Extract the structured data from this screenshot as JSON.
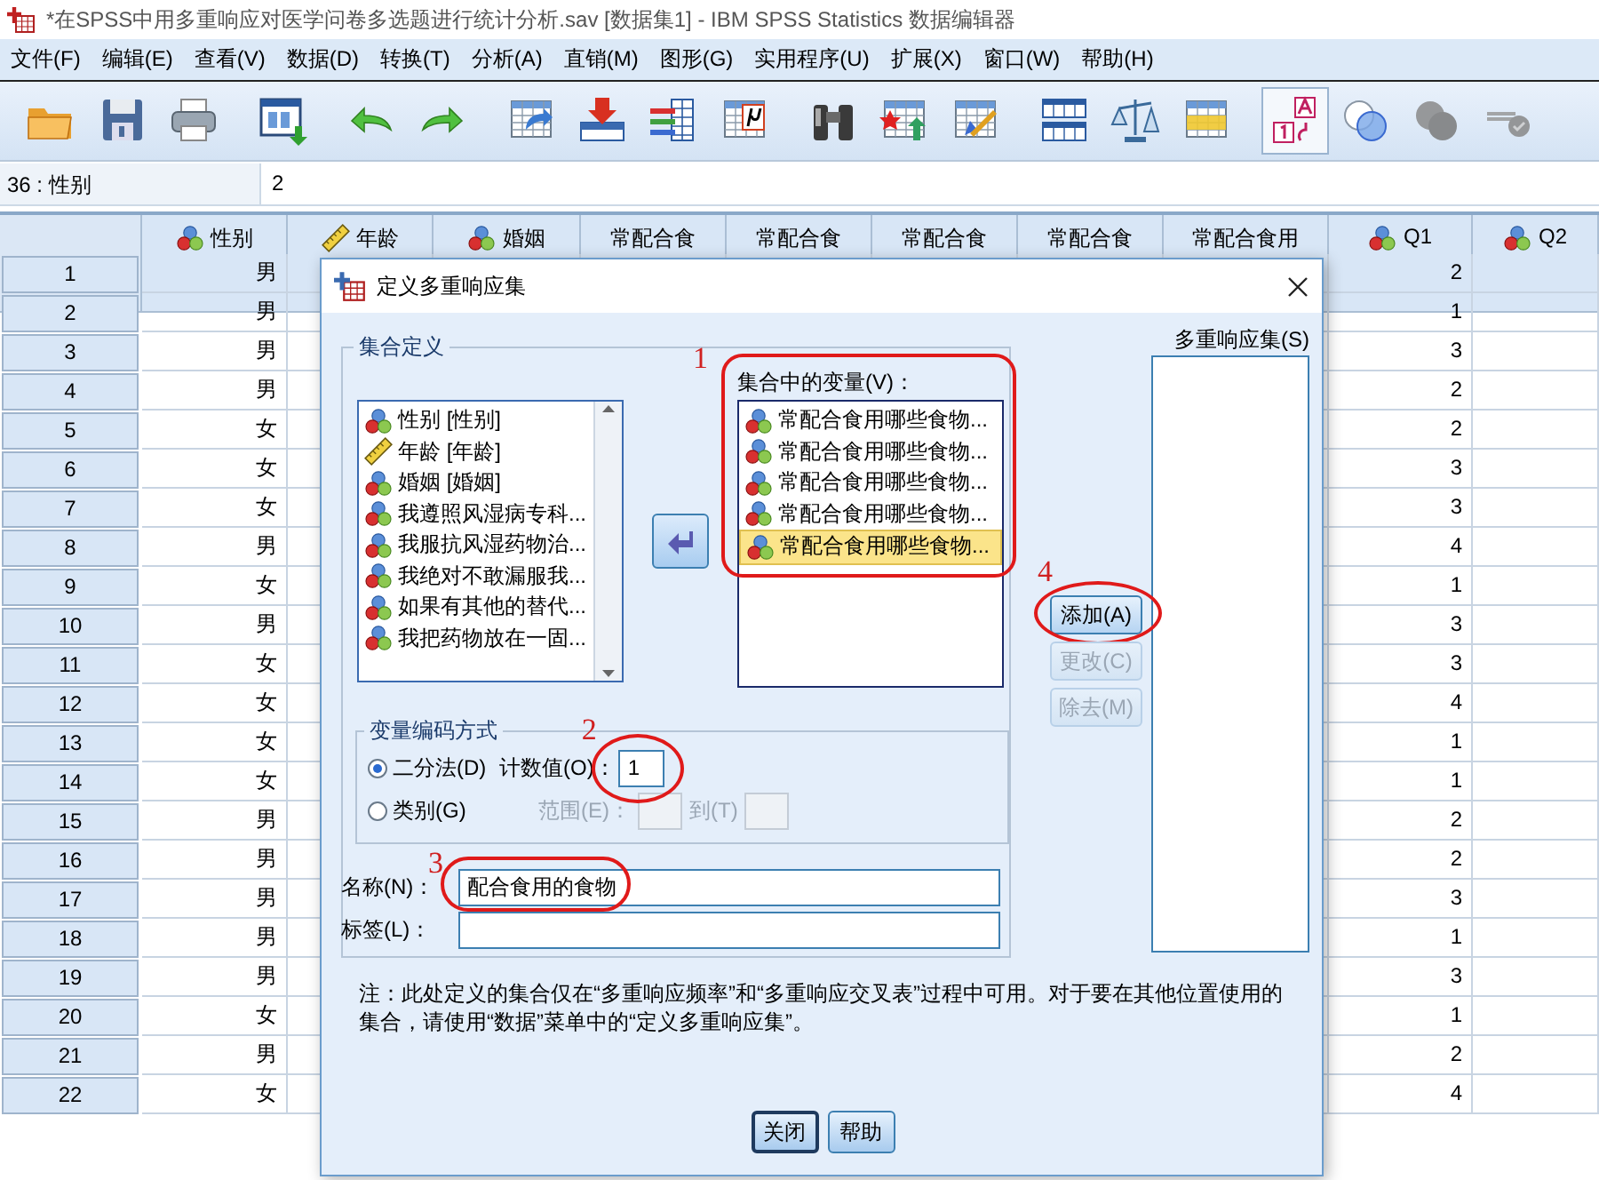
{
  "window": {
    "title": "*在SPSS中用多重响应对医学问卷多选题进行统计分析.sav [数据集1] - IBM SPSS Statistics 数据编辑器"
  },
  "menu": [
    "文件(F)",
    "编辑(E)",
    "查看(V)",
    "数据(D)",
    "转换(T)",
    "分析(A)",
    "直销(M)",
    "图形(G)",
    "实用程序(U)",
    "扩展(X)",
    "窗口(W)",
    "帮助(H)"
  ],
  "toolbar": [
    {
      "kind": "folder",
      "selected": false,
      "disabled": false
    },
    {
      "kind": "floppy",
      "selected": false,
      "disabled": false
    },
    {
      "kind": "printer",
      "selected": false,
      "disabled": false
    },
    {
      "kind": "window",
      "selected": false,
      "disabled": false
    },
    {
      "kind": "undo",
      "selected": false,
      "disabled": false
    },
    {
      "kind": "redo",
      "selected": false,
      "disabled": false
    },
    {
      "kind": "grid-arrow",
      "selected": false,
      "disabled": false
    },
    {
      "kind": "grid-down",
      "selected": false,
      "disabled": false
    },
    {
      "kind": "bars",
      "selected": false,
      "disabled": false
    },
    {
      "kind": "grid-mu",
      "selected": false,
      "disabled": false
    },
    {
      "kind": "binoculars",
      "selected": false,
      "disabled": false
    },
    {
      "kind": "grid-star",
      "selected": false,
      "disabled": false
    },
    {
      "kind": "grid-pencil",
      "selected": false,
      "disabled": false
    },
    {
      "kind": "split-grid",
      "selected": false,
      "disabled": false
    },
    {
      "kind": "scales",
      "selected": false,
      "disabled": false
    },
    {
      "kind": "grid-yellow",
      "selected": false,
      "disabled": false
    },
    {
      "kind": "labels",
      "selected": true,
      "disabled": false
    },
    {
      "kind": "circles",
      "selected": false,
      "disabled": false
    },
    {
      "kind": "grey-circles",
      "selected": false,
      "disabled": true
    },
    {
      "kind": "abc",
      "selected": false,
      "disabled": true
    }
  ],
  "cell_bar": {
    "reference": "36 : 性别",
    "value": "2"
  },
  "grid": {
    "columns": [
      {
        "name": "性别",
        "kind": "nominal"
      },
      {
        "name": "年龄",
        "kind": "scale"
      },
      {
        "name": "婚姻",
        "kind": "nominal"
      },
      {
        "name": "常配合食",
        "kind": "plain"
      },
      {
        "name": "常配合食",
        "kind": "plain"
      },
      {
        "name": "常配合食",
        "kind": "plain"
      },
      {
        "name": "常配合食",
        "kind": "plain"
      },
      {
        "name": "常配合食用",
        "kind": "plain"
      },
      {
        "name": "Q1",
        "kind": "nominal"
      },
      {
        "name": "Q2",
        "kind": "nominal"
      }
    ],
    "rows": [
      {
        "row": "1",
        "sex": "男",
        "q1": "2"
      },
      {
        "row": "2",
        "sex": "男",
        "q1": "1"
      },
      {
        "row": "3",
        "sex": "男",
        "q1": "3"
      },
      {
        "row": "4",
        "sex": "男",
        "q1": "2"
      },
      {
        "row": "5",
        "sex": "女",
        "q1": "2"
      },
      {
        "row": "6",
        "sex": "女",
        "q1": "3"
      },
      {
        "row": "7",
        "sex": "女",
        "q1": "3"
      },
      {
        "row": "8",
        "sex": "男",
        "q1": "4"
      },
      {
        "row": "9",
        "sex": "女",
        "q1": "1"
      },
      {
        "row": "10",
        "sex": "男",
        "q1": "3"
      },
      {
        "row": "11",
        "sex": "女",
        "q1": "3"
      },
      {
        "row": "12",
        "sex": "女",
        "q1": "4"
      },
      {
        "row": "13",
        "sex": "女",
        "q1": "1"
      },
      {
        "row": "14",
        "sex": "女",
        "q1": "1"
      },
      {
        "row": "15",
        "sex": "男",
        "q1": "2"
      },
      {
        "row": "16",
        "sex": "男",
        "q1": "2"
      },
      {
        "row": "17",
        "sex": "男",
        "q1": "3"
      },
      {
        "row": "18",
        "sex": "男",
        "q1": "1"
      },
      {
        "row": "19",
        "sex": "男",
        "q1": "3"
      },
      {
        "row": "20",
        "sex": "女",
        "q1": "1"
      },
      {
        "row": "21",
        "sex": "男",
        "q1": "2"
      },
      {
        "row": "22",
        "sex": "女",
        "q1": "4"
      }
    ]
  },
  "dialog": {
    "title": "定义多重响应集",
    "set_definition": {
      "title": "集合定义",
      "variables": [
        {
          "label": "性别 [性别]",
          "kind": "nominal"
        },
        {
          "label": "年龄 [年龄]",
          "kind": "scale"
        },
        {
          "label": "婚姻 [婚姻]",
          "kind": "nominal"
        },
        {
          "label": "我遵照风湿病专科...",
          "kind": "nominal"
        },
        {
          "label": "我服抗风湿药物治...",
          "kind": "nominal"
        },
        {
          "label": "我绝对不敢漏服我...",
          "kind": "nominal"
        },
        {
          "label": "如果有其他的替代...",
          "kind": "nominal"
        },
        {
          "label": "我把药物放在一固...",
          "kind": "nominal"
        }
      ],
      "set_variables_label": "集合中的变量(V)：",
      "set_variables": [
        {
          "label": "常配合食用哪些食物...",
          "kind": "nominal",
          "selected": false
        },
        {
          "label": "常配合食用哪些食物...",
          "kind": "nominal",
          "selected": false
        },
        {
          "label": "常配合食用哪些食物...",
          "kind": "nominal",
          "selected": false
        },
        {
          "label": "常配合食用哪些食物...",
          "kind": "nominal",
          "selected": false
        },
        {
          "label": "常配合食用哪些食物...",
          "kind": "nominal",
          "selected": true
        }
      ],
      "coding": {
        "title": "变量编码方式",
        "options": [
          {
            "label": "二分法(D)",
            "selected": true
          },
          {
            "label": "类别(G)",
            "selected": false
          }
        ],
        "count_label": "计数值(O)：",
        "count_value": "1",
        "range_label": "范围(E)：",
        "to_label": "到(T)",
        "range_disabled": true
      },
      "name": {
        "label": "名称(N)：",
        "value": "配合食用的食物"
      },
      "set_label": {
        "label": "标签(L)："
      }
    },
    "side_buttons": [
      {
        "label": "添加(A)",
        "disabled": false
      },
      {
        "label": "更改(C)",
        "disabled": true
      },
      {
        "label": "除去(M)",
        "disabled": true
      }
    ],
    "sets_label": "多重响应集(S)",
    "note": "注：此处定义的集合仅在“多重响应频率”和“多重响应交叉表”过程中可用。对于要在其他位置使用的集合，请使用“数据”菜单中的“定义多重响应集”。",
    "buttons": [
      {
        "label": "关闭",
        "focused": true
      },
      {
        "label": "帮助",
        "focused": false
      }
    ]
  },
  "annotations": [
    {
      "label": "1"
    },
    {
      "label": "2"
    },
    {
      "label": "3"
    },
    {
      "label": "4"
    }
  ]
}
